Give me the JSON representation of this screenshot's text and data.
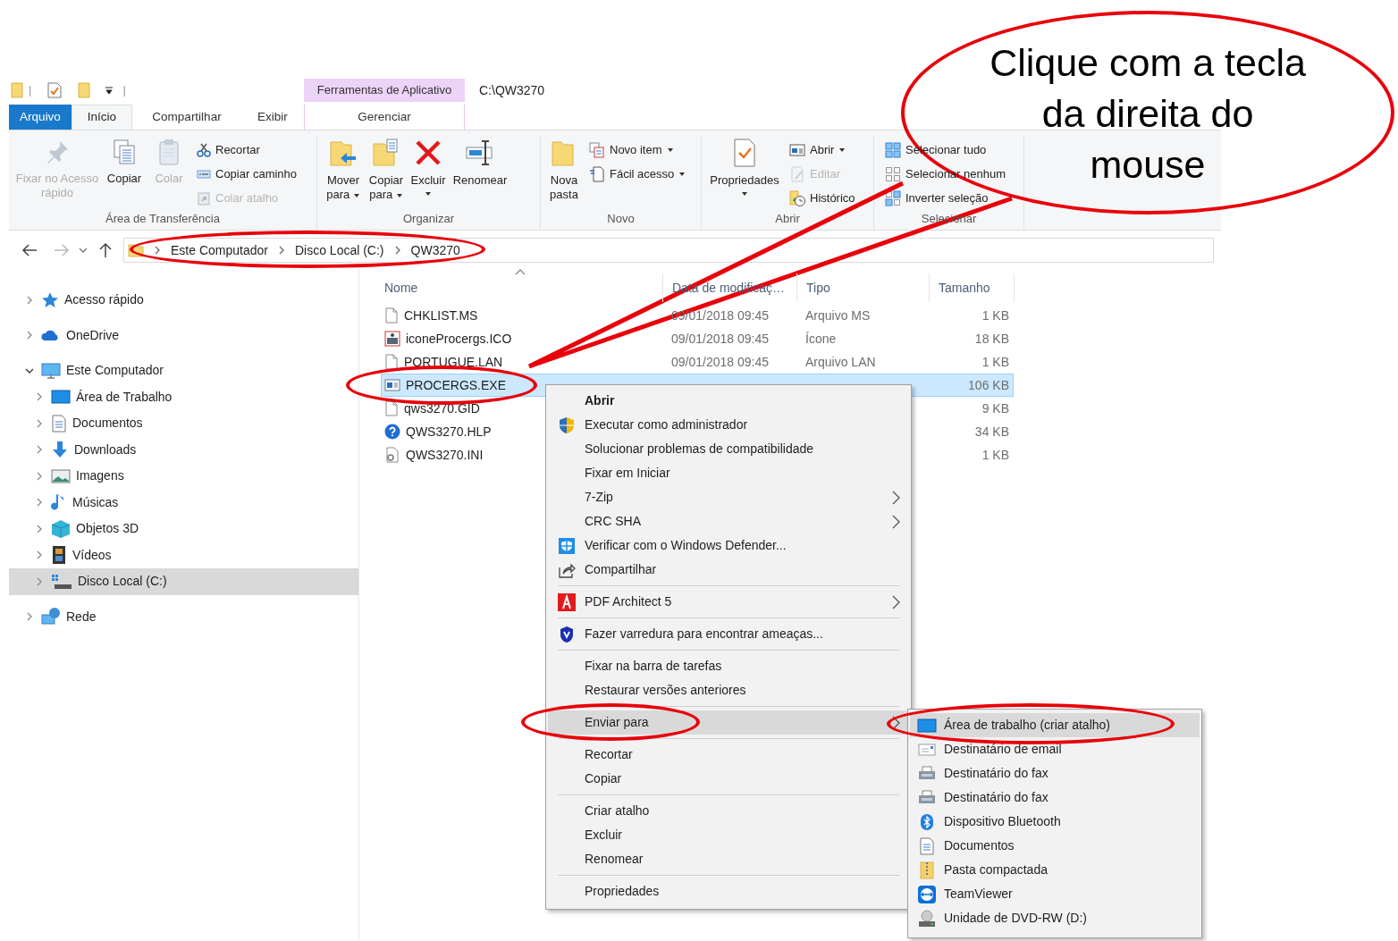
{
  "quick_access_toolbar": {
    "separators": [
      "|",
      "|"
    ]
  },
  "contextual_tab_group": {
    "label": "Ferramentas de Aplicativo"
  },
  "window": {
    "title": "C:\\QW3270"
  },
  "tabs": [
    {
      "label": "Arquivo",
      "kind": "file",
      "selected": false
    },
    {
      "label": "Início",
      "kind": "tab",
      "selected": true
    },
    {
      "label": "Compartilhar",
      "kind": "tab",
      "selected": false
    },
    {
      "label": "Exibir",
      "kind": "tab",
      "selected": false
    },
    {
      "label": "Gerenciar",
      "kind": "contextual",
      "selected": false
    }
  ],
  "ribbon": [
    {
      "group": "Área de Transferência",
      "large": [
        {
          "label": "Fixar no Acesso rápido",
          "disabled": true,
          "dropdown": false
        },
        {
          "label": "Copiar",
          "disabled": false,
          "dropdown": false
        },
        {
          "label": "Colar",
          "disabled": true,
          "dropdown": false
        }
      ],
      "small": [
        {
          "label": "Recortar",
          "disabled": false,
          "dropdown": false
        },
        {
          "label": "Copiar caminho",
          "disabled": false,
          "dropdown": false
        },
        {
          "label": "Colar atalho",
          "disabled": true,
          "dropdown": false
        }
      ]
    },
    {
      "group": "Organizar",
      "large": [
        {
          "label": "Mover para",
          "disabled": false,
          "dropdown": true
        },
        {
          "label": "Copiar para",
          "disabled": false,
          "dropdown": true
        },
        {
          "label": "Excluir",
          "disabled": false,
          "dropdown": true
        },
        {
          "label": "Renomear",
          "disabled": false,
          "dropdown": false
        }
      ]
    },
    {
      "group": "Novo",
      "large": [
        {
          "label": "Nova pasta",
          "disabled": false,
          "dropdown": false
        }
      ],
      "small": [
        {
          "label": "Novo item",
          "disabled": false,
          "dropdown": true
        },
        {
          "label": "Fácil acesso",
          "disabled": false,
          "dropdown": true
        }
      ]
    },
    {
      "group": "Abrir",
      "large": [
        {
          "label": "Propriedades",
          "disabled": false,
          "dropdown": true
        }
      ],
      "small": [
        {
          "label": "Abrir",
          "disabled": false,
          "dropdown": true
        },
        {
          "label": "Editar",
          "disabled": true,
          "dropdown": false
        },
        {
          "label": "Histórico",
          "disabled": false,
          "dropdown": false
        }
      ]
    },
    {
      "group": "Selecionar",
      "small": [
        {
          "label": "Selecionar tudo",
          "disabled": false,
          "dropdown": false
        },
        {
          "label": "Selecionar nenhum",
          "disabled": false,
          "dropdown": false
        },
        {
          "label": "Inverter seleção",
          "disabled": false,
          "dropdown": false
        }
      ]
    }
  ],
  "address_bar": {
    "breadcrumbs": [
      "Este Computador",
      "Disco Local (C:)",
      "QW3270"
    ]
  },
  "navigation_pane": [
    {
      "label": "Acesso rápido",
      "expanded": false,
      "selected": false
    },
    {
      "label": "OneDrive",
      "expanded": false,
      "selected": false
    },
    {
      "label": "Este Computador",
      "expanded": true,
      "selected": false,
      "children": [
        {
          "label": "Área de Trabalho",
          "expanded": false,
          "selected": false
        },
        {
          "label": "Documentos",
          "expanded": false,
          "selected": false
        },
        {
          "label": "Downloads",
          "expanded": false,
          "selected": false
        },
        {
          "label": "Imagens",
          "expanded": false,
          "selected": false
        },
        {
          "label": "Músicas",
          "expanded": false,
          "selected": false
        },
        {
          "label": "Objetos 3D",
          "expanded": false,
          "selected": false
        },
        {
          "label": "Vídeos",
          "expanded": false,
          "selected": false
        },
        {
          "label": "Disco Local (C:)",
          "expanded": false,
          "selected": true
        }
      ]
    },
    {
      "label": "Rede",
      "expanded": false,
      "selected": false
    }
  ],
  "file_list": {
    "columns": [
      "Nome",
      "Data de modificaç…",
      "Tipo",
      "Tamanho"
    ],
    "rows": [
      {
        "name": "CHKLIST.MS",
        "date": "09/01/2018 09:45",
        "type": "Arquivo MS",
        "size": "1 KB",
        "selected": false
      },
      {
        "name": "iconeProcergs.ICO",
        "date": "09/01/2018 09:45",
        "type": "Ícone",
        "size": "18 KB",
        "selected": false
      },
      {
        "name": "PORTUGUE.LAN",
        "date": "09/01/2018 09:45",
        "type": "Arquivo LAN",
        "size": "1 KB",
        "selected": false
      },
      {
        "name": "PROCERGS.EXE",
        "size": "106 KB",
        "selected": true
      },
      {
        "name": "qws3270.GID",
        "size": "9 KB",
        "selected": false
      },
      {
        "name": "QWS3270.HLP",
        "size": "34 KB",
        "selected": false
      },
      {
        "name": "QWS3270.INI",
        "size": "1 KB",
        "selected": false
      }
    ]
  },
  "context_menu": [
    {
      "kind": "item",
      "label": "Abrir",
      "default": true,
      "submenu": false,
      "selected": false
    },
    {
      "kind": "item",
      "label": "Executar como administrador",
      "default": false,
      "submenu": false,
      "selected": false
    },
    {
      "kind": "item",
      "label": "Solucionar problemas de compatibilidade",
      "default": false,
      "submenu": false,
      "selected": false
    },
    {
      "kind": "item",
      "label": "Fixar em Iniciar",
      "default": false,
      "submenu": false,
      "selected": false
    },
    {
      "kind": "item",
      "label": "7-Zip",
      "default": false,
      "submenu": true,
      "selected": false
    },
    {
      "kind": "item",
      "label": "CRC SHA",
      "default": false,
      "submenu": true,
      "selected": false
    },
    {
      "kind": "item",
      "label": "Verificar com o Windows Defender...",
      "default": false,
      "submenu": false,
      "selected": false
    },
    {
      "kind": "item",
      "label": "Compartilhar",
      "default": false,
      "submenu": false,
      "selected": false
    },
    {
      "kind": "separator"
    },
    {
      "kind": "item",
      "label": "PDF Architect 5",
      "default": false,
      "submenu": true,
      "selected": false
    },
    {
      "kind": "separator"
    },
    {
      "kind": "item",
      "label": "Fazer varredura para encontrar ameaças...",
      "default": false,
      "submenu": false,
      "selected": false
    },
    {
      "kind": "separator"
    },
    {
      "kind": "item",
      "label": "Fixar na barra de tarefas",
      "default": false,
      "submenu": false,
      "selected": false
    },
    {
      "kind": "item",
      "label": "Restaurar versões anteriores",
      "default": false,
      "submenu": false,
      "selected": false
    },
    {
      "kind": "separator"
    },
    {
      "kind": "item",
      "label": "Enviar para",
      "default": false,
      "submenu": true,
      "selected": true
    },
    {
      "kind": "separator"
    },
    {
      "kind": "item",
      "label": "Recortar",
      "default": false,
      "submenu": false,
      "selected": false
    },
    {
      "kind": "item",
      "label": "Copiar",
      "default": false,
      "submenu": false,
      "selected": false
    },
    {
      "kind": "separator"
    },
    {
      "kind": "item",
      "label": "Criar atalho",
      "default": false,
      "submenu": false,
      "selected": false
    },
    {
      "kind": "item",
      "label": "Excluir",
      "default": false,
      "submenu": false,
      "selected": false
    },
    {
      "kind": "item",
      "label": "Renomear",
      "default": false,
      "submenu": false,
      "selected": false
    },
    {
      "kind": "separator"
    },
    {
      "kind": "item",
      "label": "Propriedades",
      "default": false,
      "submenu": false,
      "selected": false
    }
  ],
  "send_to_submenu": [
    {
      "label": "Área de trabalho (criar atalho)",
      "selected": true
    },
    {
      "label": "Destinatário de email",
      "selected": false
    },
    {
      "label": "Destinatário do fax",
      "selected": false
    },
    {
      "label": "Destinatário do fax",
      "selected": false
    },
    {
      "label": "Dispositivo Bluetooth",
      "selected": false
    },
    {
      "label": "Documentos",
      "selected": false
    },
    {
      "label": "Pasta compactada",
      "selected": false
    },
    {
      "label": "TeamViewer",
      "selected": false
    },
    {
      "label": "Unidade de DVD-RW (D:)",
      "selected": false
    }
  ],
  "callout": {
    "lines": [
      "Clique com a tecla",
      "da direita do",
      "mouse"
    ]
  }
}
